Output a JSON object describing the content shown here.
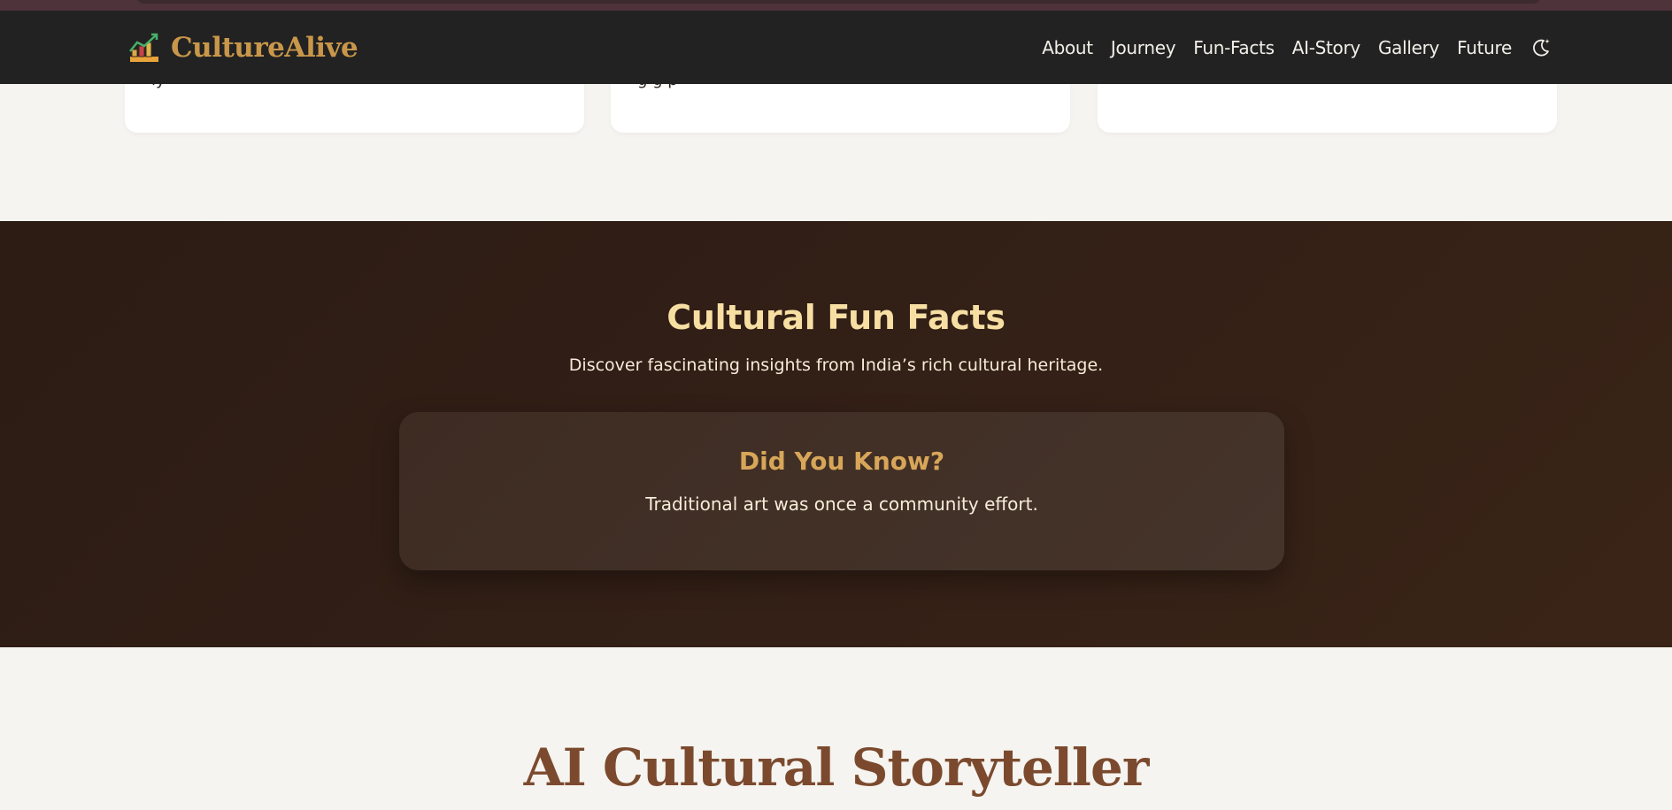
{
  "brand": {
    "name": "CultureAlive",
    "logo_icon": "chart-rising-icon",
    "color": "#c9974a"
  },
  "nav": {
    "links": [
      "About",
      "Journey",
      "Fun-Facts",
      "AI-Story",
      "Gallery",
      "Future"
    ],
    "theme_toggle_icon": "moon-stars-icon"
  },
  "cards": [
    {
      "fragment": "ly"
    },
    {
      "fragment": "g g p"
    },
    {
      "fragment": ""
    }
  ],
  "fun_facts": {
    "title": "Cultural Fun Facts",
    "subtitle": "Discover fascinating insights from India’s rich cultural heritage.",
    "card": {
      "heading": "Did You Know?",
      "text": "Traditional art was once a community effort."
    }
  },
  "storyteller": {
    "title": "AI Cultural Storyteller"
  },
  "colors": {
    "nav_bg": "#222222",
    "section_dark": "#321f16",
    "heading_gold": "#f7dfa3",
    "accent_gold": "#d8a659",
    "story_brown": "#7b4a2e",
    "page_bg": "#f6f4f0"
  }
}
